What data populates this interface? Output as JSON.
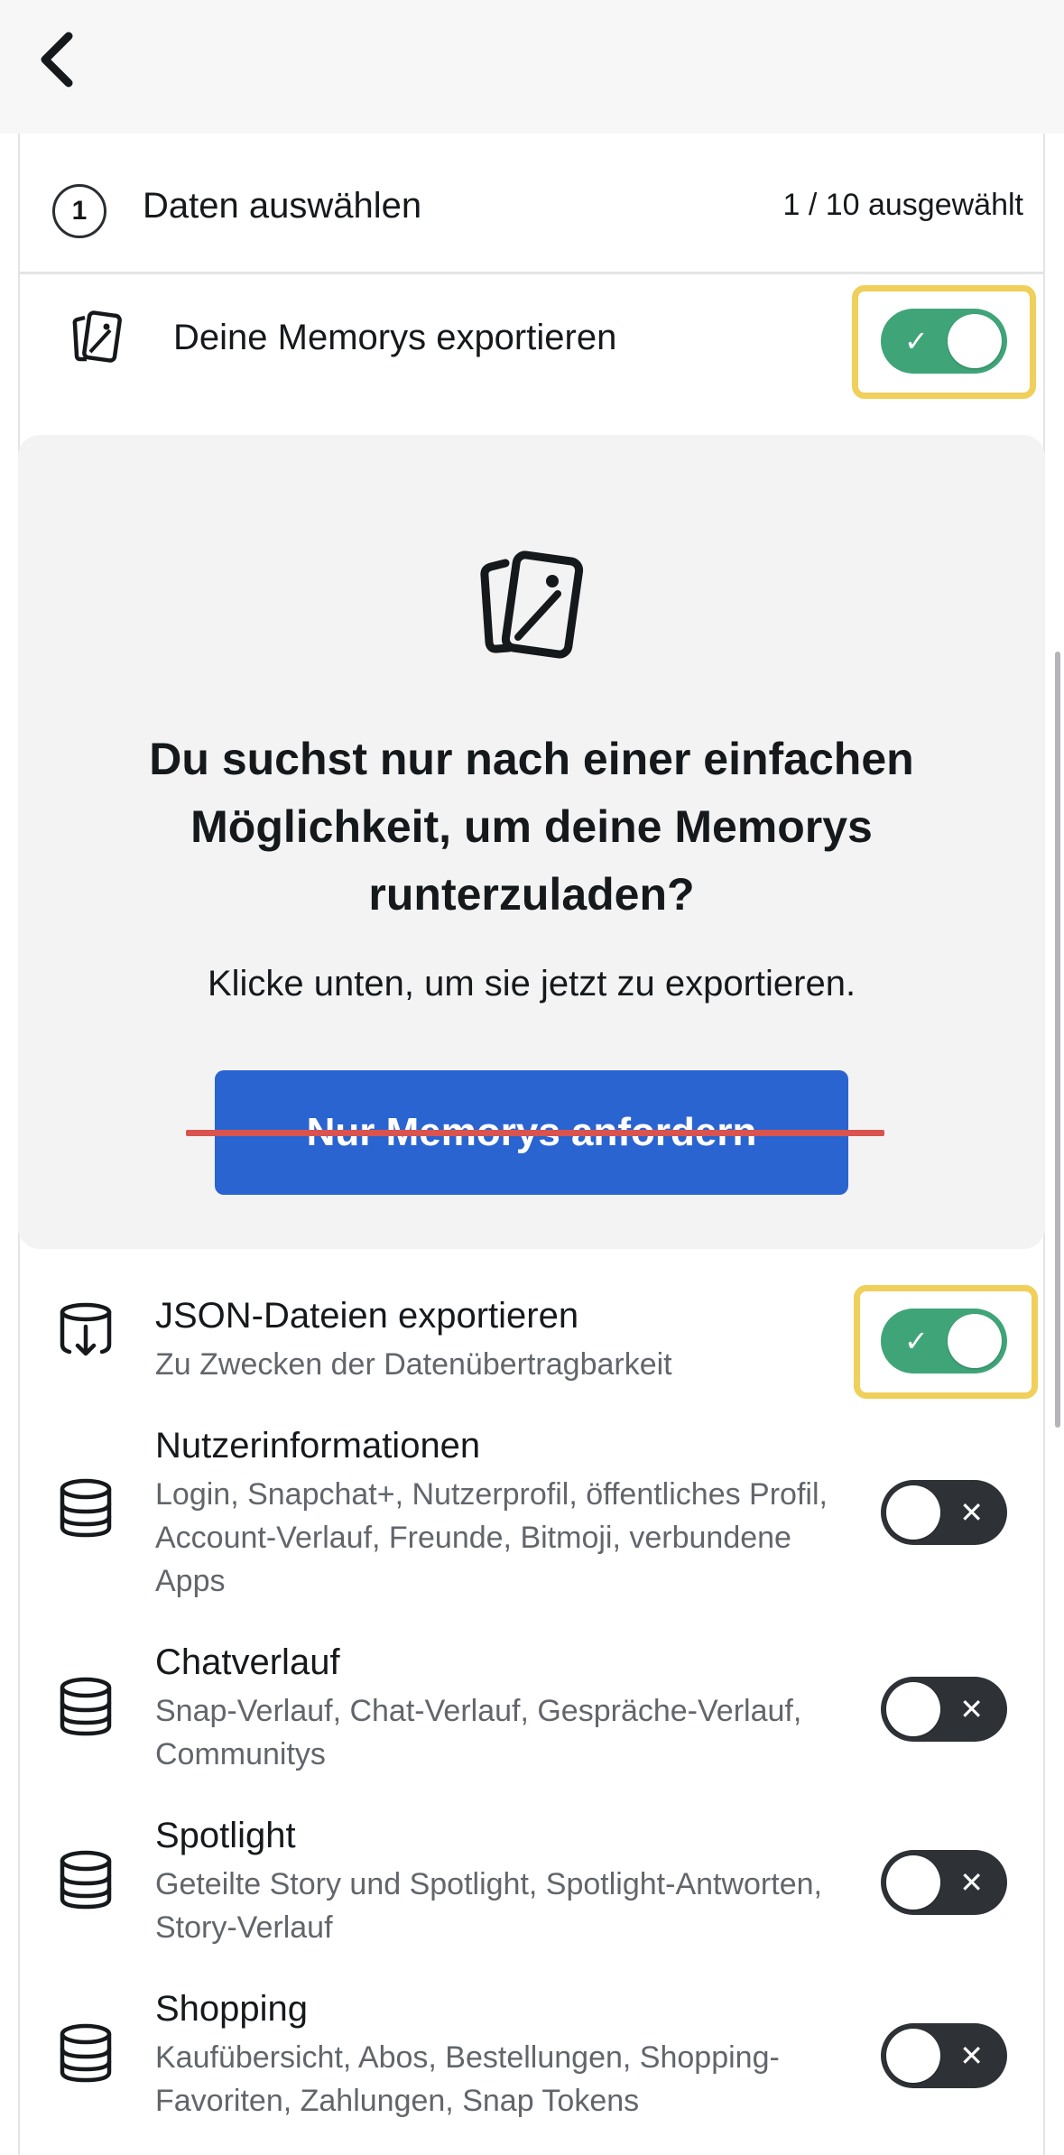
{
  "step": {
    "number": "1",
    "title": "Daten auswählen",
    "count": "1 / 10 ausgewählt"
  },
  "memories": {
    "label": "Deine Memorys exportieren",
    "enabled": true
  },
  "promo": {
    "headline": "Du suchst nur nach einer einfachen Möglichkeit, um deine Memorys runterzuladen?",
    "subtitle": "Klicke unten, um sie jetzt zu exportieren.",
    "button_label": "Nur Memorys anfordern"
  },
  "toggle_glyphs": {
    "on": "✓",
    "off": "✕"
  },
  "data_items": [
    {
      "title": "JSON-Dateien exportieren",
      "description": "Zu Zwecken der Datenübertragbarkeit",
      "icon": "download-icon",
      "enabled": true
    },
    {
      "title": "Nutzerinformationen",
      "description": "Login, Snapchat+, Nutzerprofil, öffentliches Profil, Account-Verlauf, Freunde, Bitmoji, verbundene Apps",
      "icon": "database-icon",
      "enabled": false
    },
    {
      "title": "Chatverlauf",
      "description": "Snap-Verlauf, Chat-Verlauf, Gespräche-Verlauf, Communitys",
      "icon": "database-icon",
      "enabled": false
    },
    {
      "title": "Spotlight",
      "description": "Geteilte Story und Spotlight, Spotlight-Antworten, Story-Verlauf",
      "icon": "database-icon",
      "enabled": false
    },
    {
      "title": "Shopping",
      "description": "Kaufübersicht, Abos, Bestellungen, Shopping-Favoriten, Zahlungen, Snap Tokens",
      "icon": "database-icon",
      "enabled": false
    }
  ],
  "colors": {
    "toggle_on": "#3fa578",
    "toggle_off": "#2e3136",
    "highlight": "#f0cf5a",
    "button": "#2a64d0",
    "strike": "#d9534f"
  }
}
